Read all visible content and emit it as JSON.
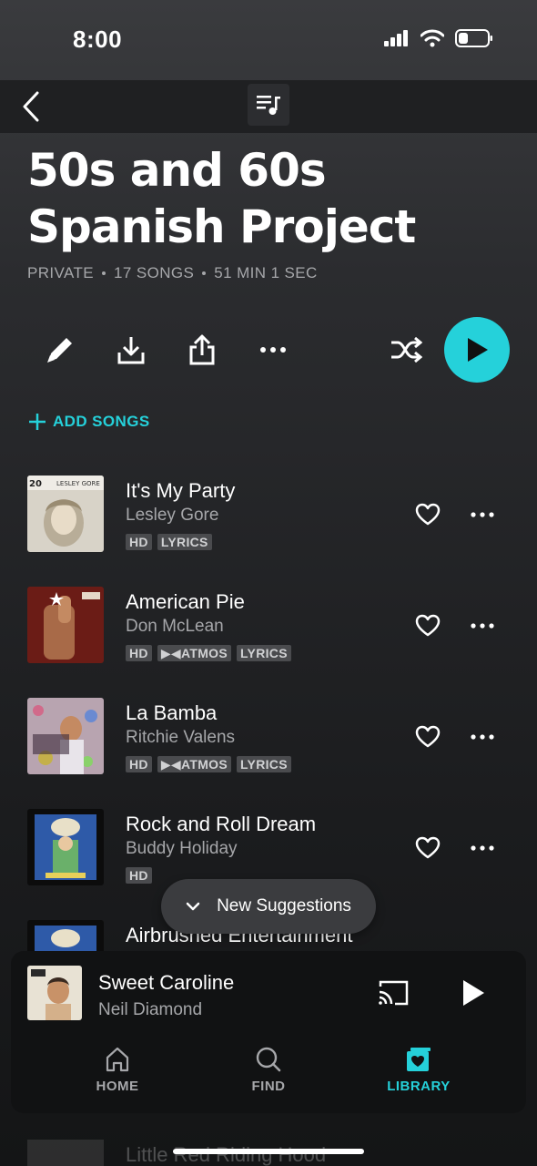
{
  "status_bar": {
    "time": "8:00"
  },
  "header": {
    "title": "50s and 60s Spanish Project",
    "meta": [
      "PRIVATE",
      "17 SONGS",
      "51 MIN 1 SEC"
    ]
  },
  "actions": {
    "icons": [
      "edit-icon",
      "download-icon",
      "share-icon",
      "more-icon",
      "shuffle-icon",
      "play-icon"
    ],
    "add_songs_label": "ADD SONGS"
  },
  "tracks": [
    {
      "title": "It's My Party",
      "artist": "Lesley Gore",
      "badges": [
        "HD",
        "LYRICS"
      ],
      "art_label": "LESLEY GORE"
    },
    {
      "title": "American Pie",
      "artist": "Don McLean",
      "badges": [
        "HD",
        "ATMOS",
        "LYRICS"
      ]
    },
    {
      "title": "La Bamba",
      "artist": "Ritchie Valens",
      "badges": [
        "HD",
        "ATMOS",
        "LYRICS"
      ]
    },
    {
      "title": "Rock and Roll Dream",
      "artist": "Buddy Holiday",
      "badges": [
        "HD"
      ]
    },
    {
      "title": "Airbrushed Entertainment",
      "artist": "",
      "badges": []
    }
  ],
  "suggestions": {
    "label": "New Suggestions"
  },
  "now_playing": {
    "title": "Sweet Caroline",
    "artist": "Neil Diamond"
  },
  "nav": {
    "items": [
      {
        "label": "HOME",
        "icon": "home-icon"
      },
      {
        "label": "FIND",
        "icon": "search-icon"
      },
      {
        "label": "LIBRARY",
        "icon": "library-icon",
        "active": true
      }
    ]
  },
  "below_panel": {
    "title": "Little Red Riding Hood"
  },
  "colors": {
    "accent": "#25d1da",
    "background": "#2b2c2f",
    "panel": "#111213"
  }
}
